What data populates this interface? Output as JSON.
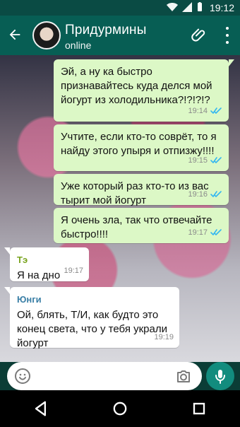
{
  "status": {
    "time": "19:12"
  },
  "chat": {
    "title": "Придурмины",
    "status": "online"
  },
  "messages": [
    {
      "text": "Эй, а ну ка быстро признавайтесь куда делся мой йогурт из холодильника?!?!?!?",
      "time": "19:14"
    },
    {
      "text": "Учтите, если кто-то соврёт, то я найду этого упыря и отпизжу!!!!",
      "time": "19:15"
    },
    {
      "text": "Уже который раз кто-то из вас тырит мой йогурт",
      "time": "19:16"
    },
    {
      "text": "Я очень зла, так что отвечайте быстро!!!!",
      "time": "19:17"
    },
    {
      "sender": "Тэ",
      "text": "Я на дно",
      "time": "19:17"
    },
    {
      "sender": "Юнги",
      "text": "Ой, блять, Т/И, как будто это конец света, что у тебя украли йогурт",
      "time": "19:19"
    }
  ],
  "composer": {
    "placeholder": ""
  },
  "icons": {
    "back": "arrow-back-icon",
    "attach": "paperclip-icon",
    "more": "more-vert-icon",
    "emoji": "smile-icon",
    "camera": "camera-icon",
    "mic": "mic-icon",
    "ticks": "double-check-icon"
  },
  "colors": {
    "appbar": "#075e54",
    "statusbar": "#0a4b44",
    "outgoing": "#dcf8c6",
    "incoming": "#ffffff",
    "ticks": "#34b7f1",
    "accent_te": "#7aa41f",
    "accent_yungi": "#3a7fa6",
    "mic": "#128c7e"
  }
}
